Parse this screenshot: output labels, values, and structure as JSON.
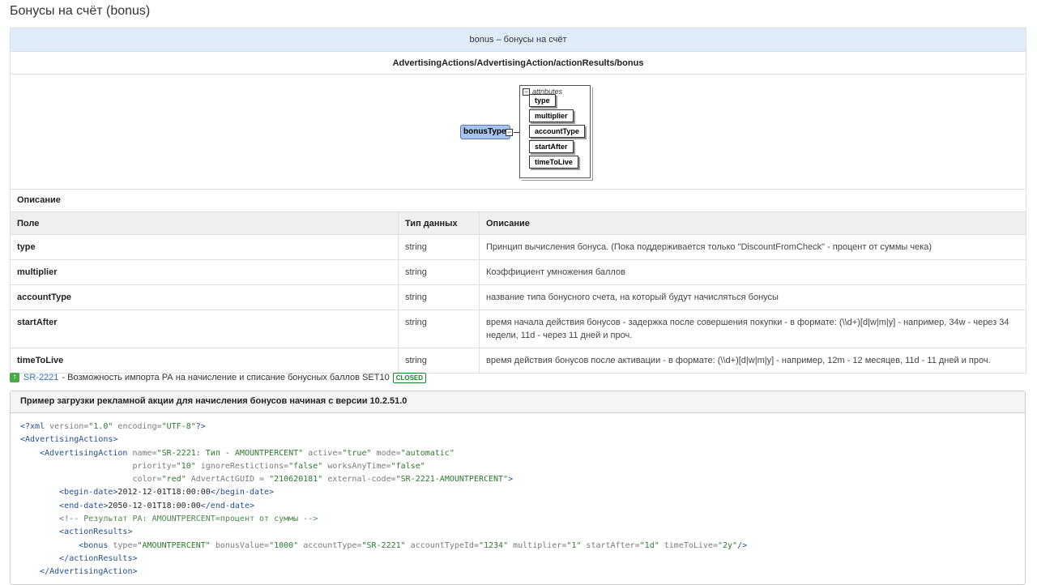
{
  "page": {
    "title": "Бонусы на счёт (bonus)"
  },
  "table": {
    "caption": "bonus – бонусы на счёт",
    "path": "AdvertisingActions/AdvertisingAction/actionResults/bonus",
    "diagram": {
      "type_node": "bonusType",
      "group_label": "attributes",
      "attributes": [
        "type",
        "multiplier",
        "accountType",
        "startAfter",
        "timeToLive"
      ]
    },
    "section": "Описание",
    "headers": {
      "field": "Поле",
      "dtype": "Тип данных",
      "desc": "Описание"
    },
    "rows": [
      {
        "field": "type",
        "dtype": "string",
        "desc": "Принцип вычисления бонуса. (Пока поддерживается только \"DiscountFromCheck\" - процент от суммы чека)"
      },
      {
        "field": "multiplier",
        "dtype": "string",
        "desc": "Коэффициент умножения баллов"
      },
      {
        "field": "accountType",
        "dtype": "string",
        "desc": "название типа бонусного счета, на который будут начисляться бонусы"
      },
      {
        "field": "startAfter",
        "dtype": "string",
        "desc": "время начала действия бонусов - задержка после совершения покупки - в формате: (\\\\d+)[d|w|m|y] - например, 34w - через 34 недели, 11d - через 11 дней и проч."
      },
      {
        "field": "timeToLive",
        "dtype": "string",
        "desc": "время действия бонусов после активации - в формате: (\\\\d+)[d|w|m|y] - например, 12m - 12 месяцев, 11d - 11 дней и проч."
      }
    ]
  },
  "issue": {
    "key": "SR-2221",
    "summary": " - Возможность импорта РА на начисление и списание бонусных баллов SET10",
    "status": "CLOSED",
    "colors": {
      "icon": "#49a847",
      "status": "#14892c",
      "link": "#3572b0"
    }
  },
  "code_panel": {
    "title": "Пример загрузки рекламной акции для начисления бонусов начиная с версии 10.2.51.0",
    "lines": {
      "l1_open": "<?xml ",
      "l1_a1": "version=",
      "l1_v1": "\"1.0\"",
      "l1_a2": " encoding=",
      "l1_v2": "\"UTF-8\"",
      "l1_close": "?>",
      "l2": "<AdvertisingActions>",
      "l3_tag": "    <AdvertisingAction",
      "l3_a1": " name=",
      "l3_v1": "\"SR-2221: Тип - AMOUNTPERCENT\"",
      "l3_a2": " active=",
      "l3_v2": "\"true\"",
      "l3_a3": " mode=",
      "l3_v3": "\"automatic\"",
      "l4_a1": "                       priority=",
      "l4_v1": "\"10\"",
      "l4_a2": " ignoreRestictions=",
      "l4_v2": "\"false\"",
      "l4_a3": " worksAnyTime=",
      "l4_v3": "\"false\"",
      "l5_a1": "                       color=",
      "l5_v1": "\"red\"",
      "l5_a2": " AdvertActGUID = ",
      "l5_v2": "\"210620181\"",
      "l5_a3": " external-code=",
      "l5_v3": "\"SR-2221-AMOUNTPERCENT\"",
      "l5_close": ">",
      "l6_open": "        <begin-date>",
      "l6_text": "2012-12-01T18:00:00",
      "l6_close": "</begin-date>",
      "l7_open": "        <end-date>",
      "l7_text": "2050-12-01T18:00:00",
      "l7_close": "</end-date>",
      "l8": "        <!-- Результат РА: AMOUNTPERCENT=процент от суммы -->",
      "l9": "        <actionResults>",
      "l10_tag": "            <bonus",
      "l10_a1": " type=",
      "l10_v1": "\"AMOUNTPERCENT\"",
      "l10_a2": " bonusValue=",
      "l10_v2": "\"1000\"",
      "l10_a3": " accountType=",
      "l10_v3": "\"SR-2221\"",
      "l10_a4": " accountTypeId=",
      "l10_v4": "\"1234\"",
      "l10_a5": " multiplier=",
      "l10_v5": "\"1\"",
      "l10_a6": " startAfter=",
      "l10_v6": "\"1d\"",
      "l10_a7": " timeToLive=",
      "l10_v7": "\"2y\"",
      "l10_close": "/>",
      "l11": "        </actionResults>",
      "l12": "    </AdvertisingAction>"
    }
  }
}
